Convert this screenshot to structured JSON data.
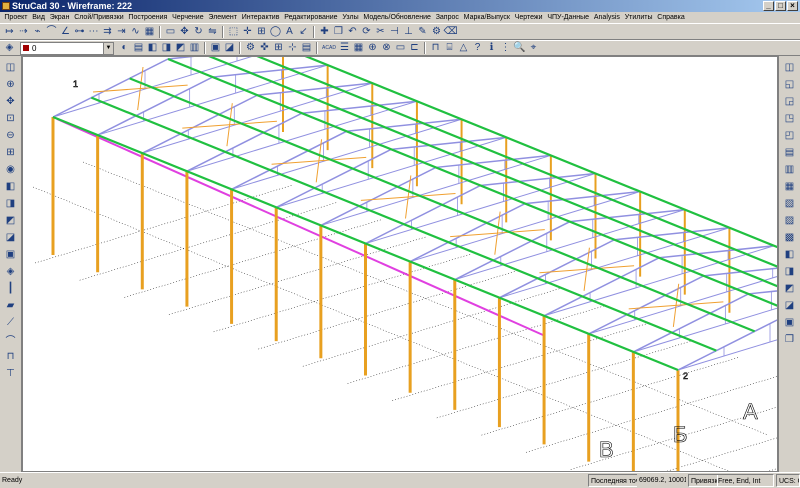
{
  "window": {
    "title": "StruCad 30 - Wireframe: 222",
    "minimize_label": "_",
    "maximize_label": "□",
    "close_label": "×"
  },
  "menu": [
    "Проект",
    "Вид",
    "Экран",
    "Слой/Привязки",
    "Построения",
    "Черчение",
    "Элемент",
    "Интерактив",
    "Редактирование",
    "Узлы",
    "Модель/Обновление",
    "Запрос",
    "Марка/Выпуск",
    "Чертежи",
    "ЧПУ-Данные",
    "Analysis",
    "Утилиты",
    "Справка"
  ],
  "toolbar": {
    "layer_value": "0",
    "layer_color": "#a00000",
    "acad_label": "ACAD",
    "text_tool_label": "A"
  },
  "viewport": {
    "grid_labels": [
      "1",
      "2",
      "А",
      "Б",
      "В"
    ],
    "colors": {
      "columns": "#e8a020",
      "trusses": "#9090e0",
      "purlins": "#20c040",
      "bracing": "#f0a030",
      "rail": "#e040e0",
      "gridlines": "#000000"
    }
  },
  "status": {
    "ready": "Ready",
    "last_point_label": "Последняя точка: (",
    "last_point_value": "69069.2,    100016.8,         0.0)",
    "snap_label": "Привязки:",
    "snap_value": "Free, End, Int",
    "ucs": "UCS: O"
  }
}
